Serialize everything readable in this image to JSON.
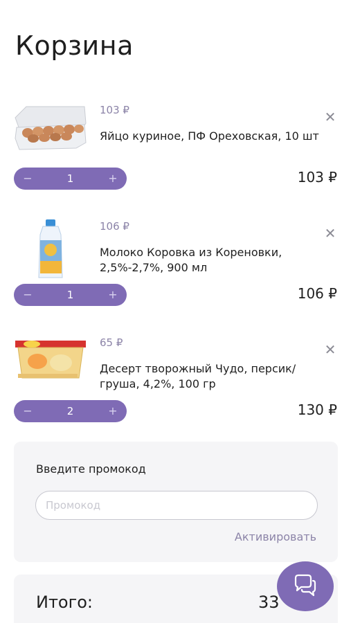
{
  "page": {
    "title": "Корзина"
  },
  "cart": {
    "items": [
      {
        "unit_price": "103 ₽",
        "name": "Яйцо куриное, ПФ Ореховская, 10 шт",
        "quantity": "1",
        "total": "103 ₽",
        "minus": "−",
        "plus": "+",
        "remove": "✕",
        "image_icon": "egg-carton-image"
      },
      {
        "unit_price": "106 ₽",
        "name": "Молоко Коровка из Кореновки, 2,5%-2,7%, 900 мл",
        "quantity": "1",
        "total": "106 ₽",
        "minus": "−",
        "plus": "+",
        "remove": "✕",
        "image_icon": "milk-bottle-image"
      },
      {
        "unit_price": "65 ₽",
        "name": "Десерт творожный Чудо, персик/груша, 4,2%, 100 гр",
        "quantity": "2",
        "total": "130 ₽",
        "minus": "−",
        "plus": "+",
        "remove": "✕",
        "image_icon": "dessert-cup-image"
      }
    ]
  },
  "promo": {
    "title": "Введите промокод",
    "placeholder": "Промокод",
    "value": "",
    "activate_label": "Активировать"
  },
  "total": {
    "label": "Итого:",
    "value": "33"
  },
  "chat": {
    "icon": "chat-bubbles-icon"
  },
  "colors": {
    "accent": "#7f6bb5",
    "muted_text": "#8c84a8",
    "panel_bg": "#f5f5f7"
  }
}
